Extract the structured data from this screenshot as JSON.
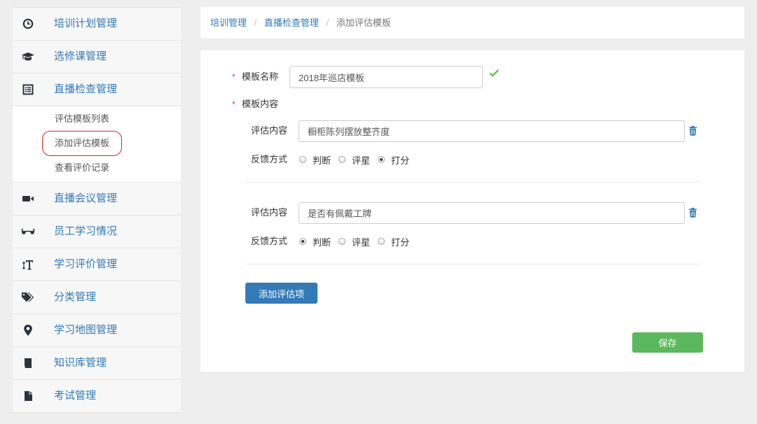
{
  "colors": {
    "page_bg": "#eeeeee",
    "link": "#337ab7",
    "icon_dark": "#2a3440",
    "primary_button": "#337ab7",
    "success_button": "#5cb85c",
    "required_star": "#e4393c",
    "check": "#5cb85c",
    "annotation": "#d9251c"
  },
  "sidebar": {
    "items": [
      {
        "label": "培训计划管理",
        "icon": "clock-icon"
      },
      {
        "label": "选修课管理",
        "icon": "graduation-cap-icon"
      },
      {
        "label": "直播检查管理",
        "icon": "list-alt-icon",
        "expanded": true
      },
      {
        "label": "直播会议管理",
        "icon": "video-camera-icon"
      },
      {
        "label": "员工学习情况",
        "icon": "eyeglasses-icon"
      },
      {
        "label": "学习评价管理",
        "icon": "text-height-icon"
      },
      {
        "label": "分类管理",
        "icon": "tags-icon"
      },
      {
        "label": "学习地图管理",
        "icon": "map-marker-icon"
      },
      {
        "label": "知识库管理",
        "icon": "book-icon"
      },
      {
        "label": "考试管理",
        "icon": "file-icon"
      }
    ],
    "submenu": {
      "items": [
        {
          "label": "评估模板列表",
          "active": false
        },
        {
          "label": "添加评估模板",
          "active": true,
          "annotated": true
        },
        {
          "label": "查看评价记录",
          "active": false
        }
      ]
    }
  },
  "breadcrumb": {
    "separator": "/",
    "items": [
      {
        "label": "培训管理",
        "link": true
      },
      {
        "label": "直播检查管理",
        "link": true
      },
      {
        "label": "添加评估模板",
        "link": false
      }
    ]
  },
  "form": {
    "required_mark": "*",
    "template_name": {
      "label": "模板名称",
      "required": true,
      "value": "2018年巡店模板",
      "valid": true,
      "status_icon": "check-icon"
    },
    "template_content": {
      "label": "模板内容",
      "required": true
    },
    "criteria": [
      {
        "content_label": "评估内容",
        "content_value": "橱柜陈列摆放整齐度",
        "delete_icon": "trash-icon",
        "feedback_label": "反馈方式",
        "feedback_options": [
          {
            "label": "判断",
            "checked": false
          },
          {
            "label": "评星",
            "checked": false
          },
          {
            "label": "打分",
            "checked": true
          }
        ]
      },
      {
        "content_label": "评估内容",
        "content_value": "是否有佩戴工牌",
        "delete_icon": "trash-icon",
        "feedback_label": "反馈方式",
        "feedback_options": [
          {
            "label": "判断",
            "checked": true
          },
          {
            "label": "评星",
            "checked": false
          },
          {
            "label": "打分",
            "checked": false
          }
        ]
      }
    ],
    "add_button_label": "添加评估项",
    "save_button_label": "保存"
  }
}
